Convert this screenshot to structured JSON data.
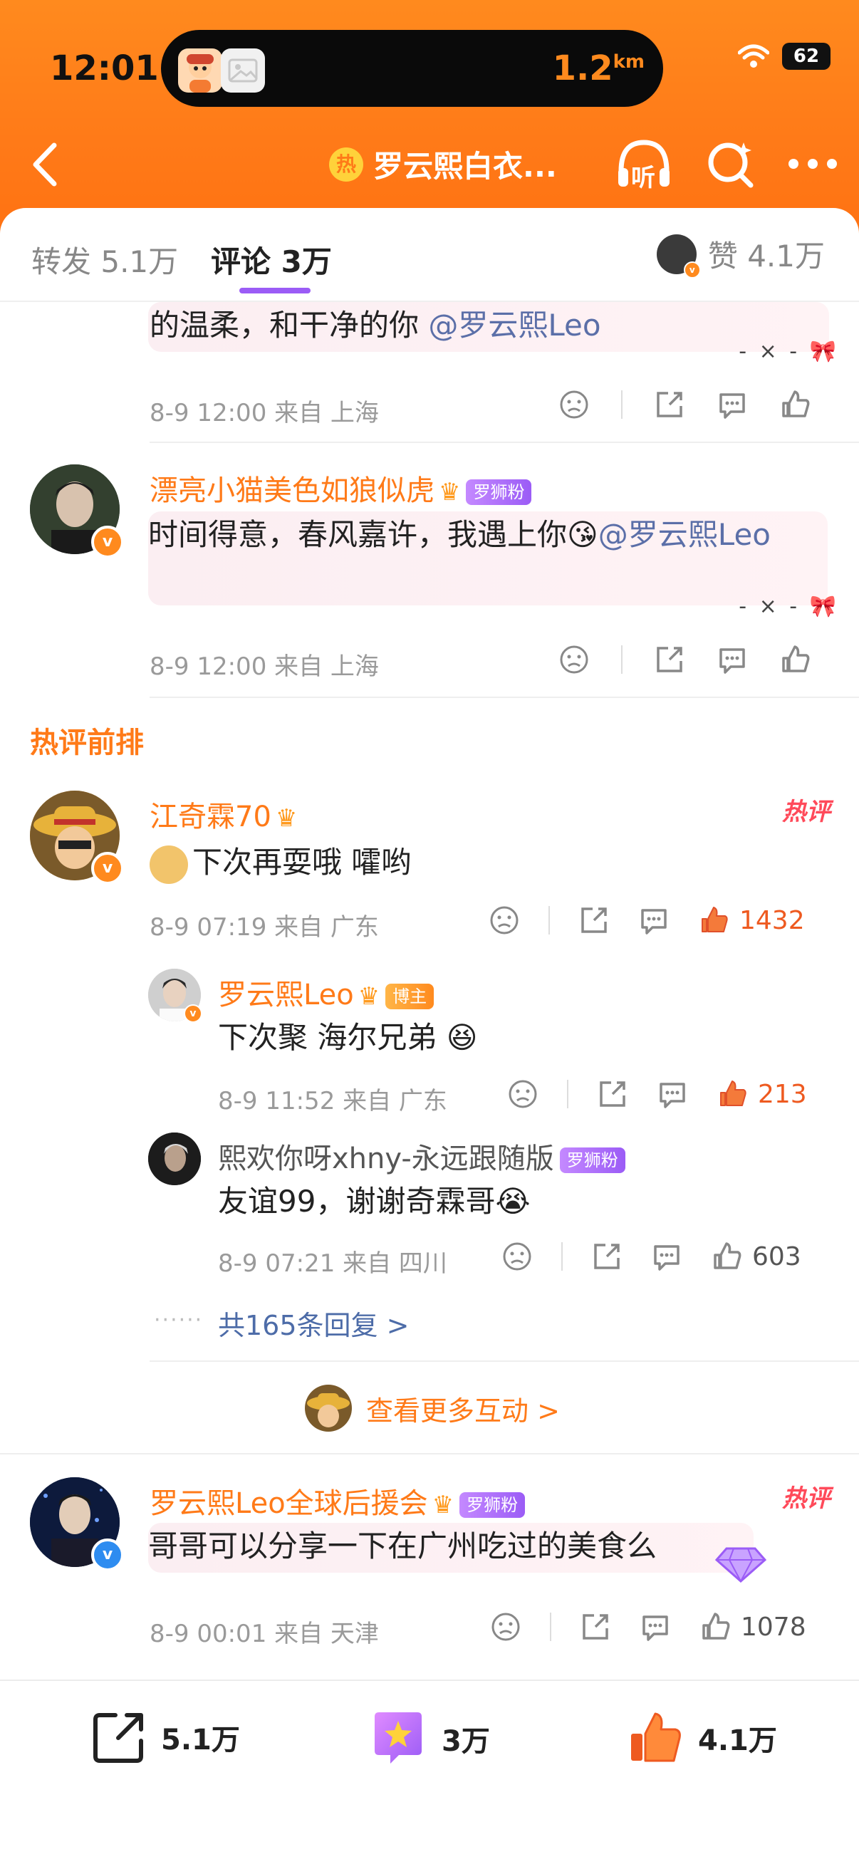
{
  "status_bar": {
    "time": "12:01",
    "island_distance": "1.2",
    "island_unit": "km",
    "battery": "62"
  },
  "nav": {
    "hot_mark": "热",
    "title": "罗云熙白衣...",
    "listen_label": "听"
  },
  "tabs": {
    "repost": "转发 5.1万",
    "comments": "评论 3万",
    "likes": "赞 4.1万"
  },
  "comments_top": [
    {
      "text": "的温柔，和干净的你 ",
      "mention": "@罗云熙Leo",
      "meta": "8-9 12:00  来自 上海"
    },
    {
      "user": "漂亮小猫美色如狼似虎",
      "badge": "罗狮粉",
      "text": "时间得意，春风嘉许，我遇上你😘",
      "mention": "@罗云熙Leo",
      "meta": "8-9 12:00  来自 上海"
    }
  ],
  "section_title": "热评前排",
  "hot_tag": "热评",
  "hot_comment": {
    "user": "江奇霖70",
    "text": "下次再耍哦 嚯哟",
    "meta": "8-9 07:19  来自 广东",
    "likes": "1432",
    "replies": [
      {
        "user": "罗云熙Leo",
        "badge": "博主",
        "text": "下次聚 海尔兄弟 😆",
        "meta": "8-9 11:52  来自 广东",
        "likes": "213"
      },
      {
        "user": "熙欢你呀xhny-永远跟随版",
        "badge": "罗狮粉",
        "text": "友谊99，谢谢奇霖哥😭",
        "meta": "8-9 07:21  来自 四川",
        "likes": "603"
      }
    ],
    "more_replies": "共165条回复 >",
    "see_more": "查看更多互动 >"
  },
  "third_comment": {
    "user": "罗云熙Leo全球后援会",
    "badge": "罗狮粉",
    "text": "哥哥可以分享一下在广州吃过的美食么",
    "meta": "8-9 00:01  来自 天津",
    "likes": "1078"
  },
  "bottom_bar": {
    "repost": "5.1万",
    "comment": "3万",
    "like": "4.1万"
  },
  "colors": {
    "brand_orange": "#ff7a18",
    "accent_purple": "#9b5cf6",
    "like_orange": "#ee5a20",
    "mention_blue": "#5b6fa8"
  }
}
